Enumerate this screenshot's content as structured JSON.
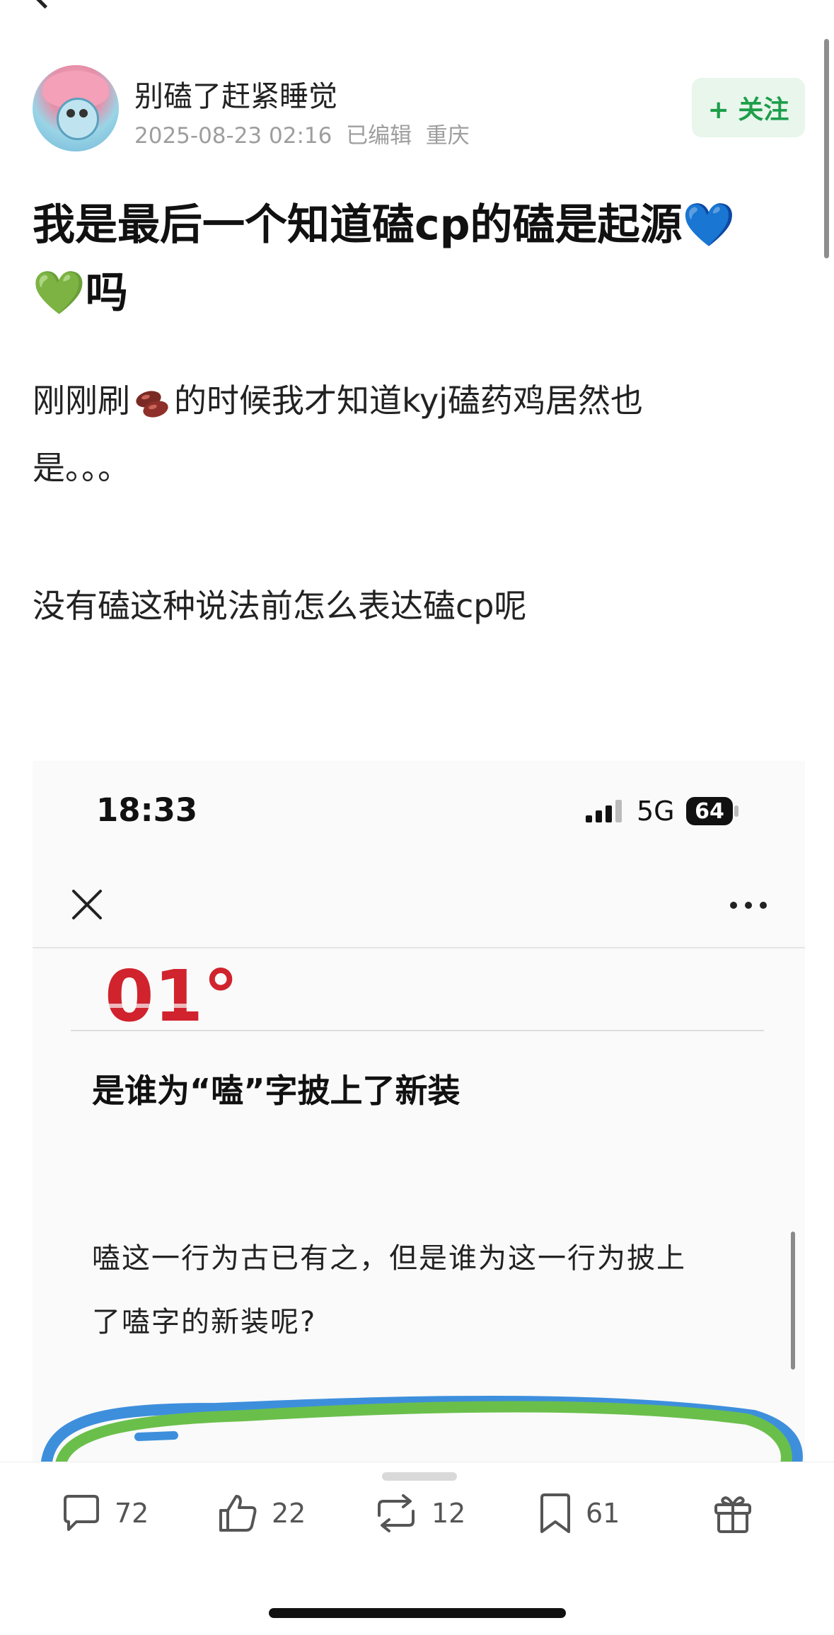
{
  "author": {
    "name": "别磕了赶紧睡觉",
    "timestamp": "2025-08-23 02:16",
    "edited": "已编辑",
    "location": "重庆",
    "follow_label": "+ 关注"
  },
  "post": {
    "title": "我是最后一个知道磕cp的磕是起源",
    "title_heart_blue": "💙",
    "title_heart_green": "💚",
    "title_suffix": "吗",
    "line1_before": "刚刚刷",
    "line1_after": "的时候我才知道kyj磕药鸡居然也",
    "line2": "是。。。",
    "line3": "没有磕这种说法前怎么表达磕cp呢"
  },
  "embedded_screenshot": {
    "time": "18:33",
    "network": "5G",
    "battery": "64",
    "logo_text": "01°",
    "heading": "是谁为“嗑”字披上了新装",
    "paragraph_line1": "嗑这一行为古已有之，但是谁为这一行为披上",
    "paragraph_line2": "了嗑字的新装呢?"
  },
  "actions": {
    "comments": "72",
    "likes": "22",
    "reposts": "12",
    "bookmarks": "61"
  },
  "colors": {
    "follow_green": "#1e9e4a",
    "follow_bg": "#e8f6ec",
    "logo_red": "#d0232d",
    "scribble_blue": "#3d8fdc",
    "scribble_green": "#6abf4b"
  }
}
